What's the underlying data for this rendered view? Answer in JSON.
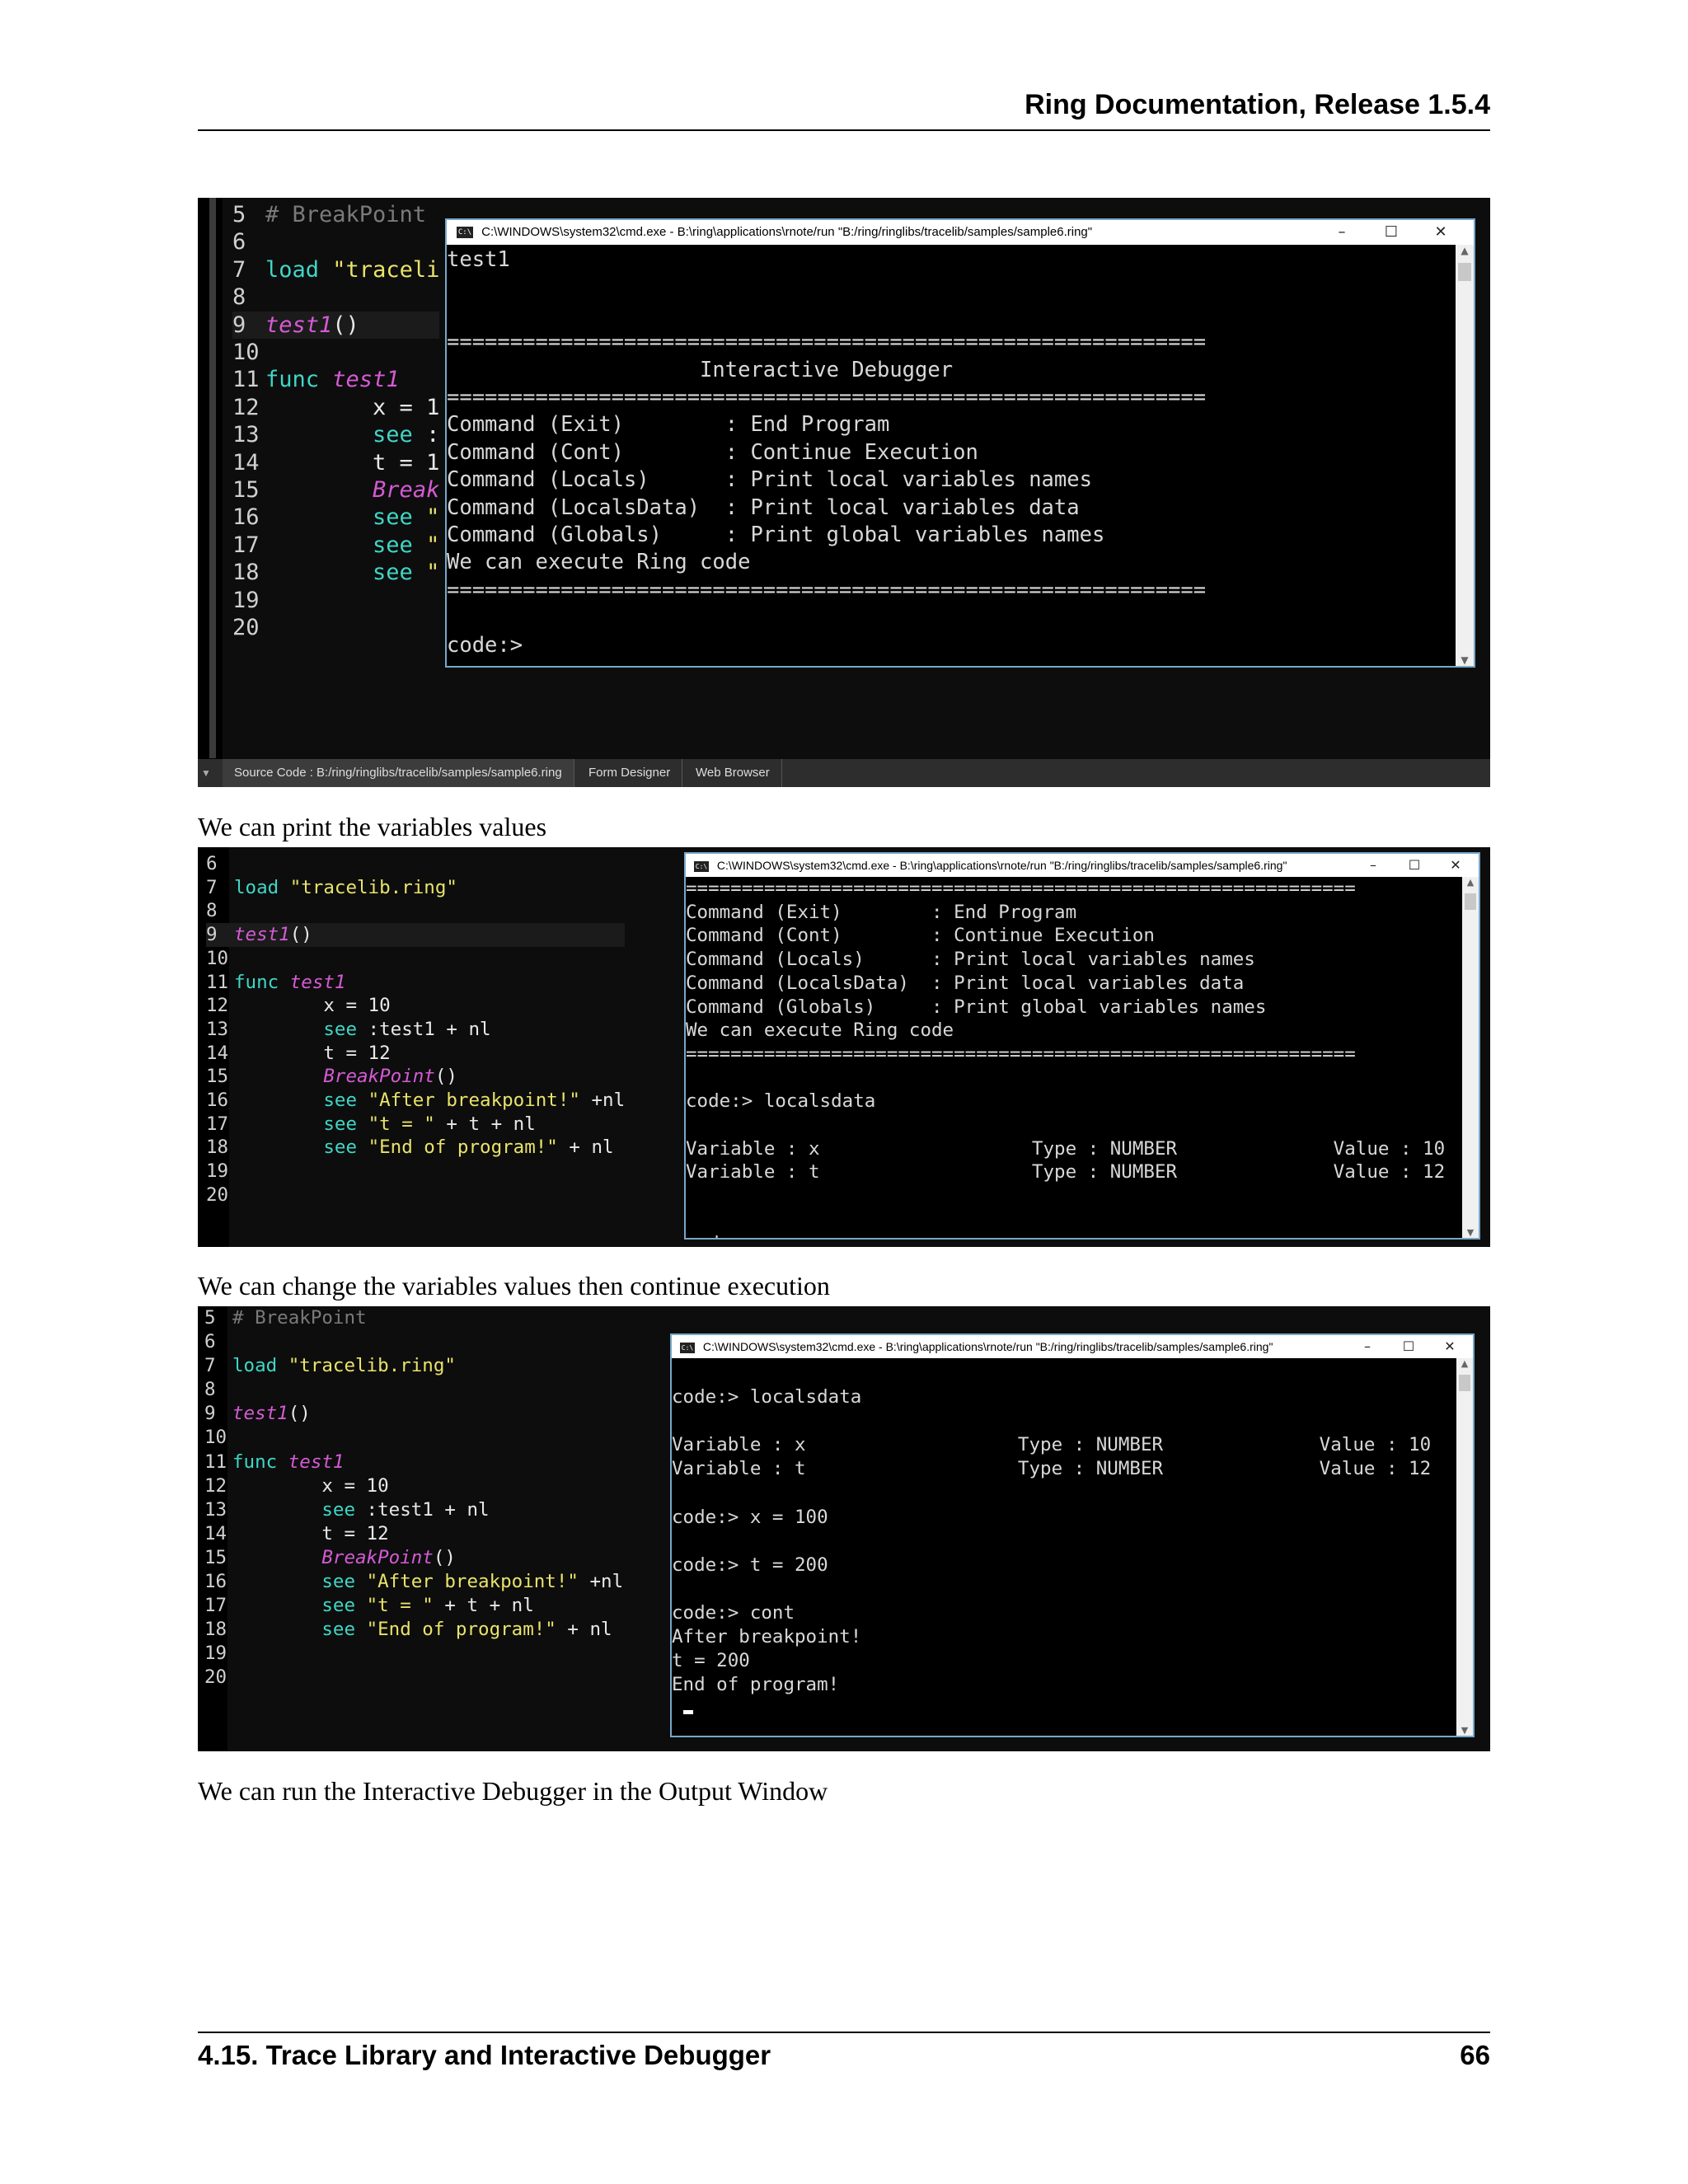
{
  "header": {
    "title": "Ring Documentation, Release 1.5.4"
  },
  "footer": {
    "section": "4.15.  Trace Library and Interactive Debugger",
    "page_number": "66"
  },
  "captions": {
    "print_values": "We can print the variables values",
    "change_values": "We can change the variables values then continue execution",
    "output_window": "We can run the Interactive Debugger in the Output Window"
  },
  "screenshot1": {
    "code_lines": [
      {
        "n": "5",
        "t": "# BreakPoint"
      },
      {
        "n": "6",
        "t": ""
      },
      {
        "n": "7",
        "t": "load \"traceli"
      },
      {
        "n": "8",
        "t": ""
      },
      {
        "n": "9",
        "t": "test1()"
      },
      {
        "n": "10",
        "t": ""
      },
      {
        "n": "11",
        "t": "func test1"
      },
      {
        "n": "12",
        "t": "        x = 1"
      },
      {
        "n": "13",
        "t": "        see :"
      },
      {
        "n": "14",
        "t": "        t = 1"
      },
      {
        "n": "15",
        "t": "        Break"
      },
      {
        "n": "16",
        "t": "        see \""
      },
      {
        "n": "17",
        "t": "        see \""
      },
      {
        "n": "18",
        "t": "        see \""
      },
      {
        "n": "19",
        "t": ""
      },
      {
        "n": "20",
        "t": ""
      }
    ],
    "terminal": {
      "title": "C:\\WINDOWS\\system32\\cmd.exe - B:\\ring\\applications\\rnote/run  \"B:/ring/ringlibs/tracelib/samples/sample6.ring\"",
      "lines": [
        "test1",
        "",
        "",
        "============================================================",
        "                    Interactive Debugger",
        "============================================================",
        "Command (Exit)        : End Program",
        "Command (Cont)        : Continue Execution",
        "Command (Locals)      : Print local variables names",
        "Command (LocalsData)  : Print local variables data",
        "Command (Globals)     : Print global variables names",
        "We can execute Ring code",
        "============================================================",
        "",
        "code:>"
      ]
    },
    "tabs": [
      "Source Code : B:/ring/ringlibs/tracelib/samples/sample6.ring",
      "Form Designer",
      "Web Browser"
    ]
  },
  "screenshot2": {
    "code_lines": [
      {
        "n": "6",
        "t": ""
      },
      {
        "n": "7",
        "t": "load \"tracelib.ring\""
      },
      {
        "n": "8",
        "t": ""
      },
      {
        "n": "9",
        "t": "test1()"
      },
      {
        "n": "10",
        "t": ""
      },
      {
        "n": "11",
        "t": "func test1"
      },
      {
        "n": "12",
        "t": "        x = 10"
      },
      {
        "n": "13",
        "t": "        see :test1 + nl"
      },
      {
        "n": "14",
        "t": "        t = 12"
      },
      {
        "n": "15",
        "t": "        BreakPoint()"
      },
      {
        "n": "16",
        "t": "        see \"After breakpoint!\" +nl"
      },
      {
        "n": "17",
        "t": "        see \"t = \" + t + nl"
      },
      {
        "n": "18",
        "t": "        see \"End of program!\" + nl"
      },
      {
        "n": "19",
        "t": ""
      },
      {
        "n": "20",
        "t": ""
      }
    ],
    "terminal": {
      "title": "C:\\WINDOWS\\system32\\cmd.exe - B:\\ring\\applications\\rnote/run  \"B:/ring/ringlibs/tracelib/samples/sample6.ring\"",
      "lines": [
        "============================================================",
        "Command (Exit)        : End Program",
        "Command (Cont)        : Continue Execution",
        "Command (Locals)      : Print local variables names",
        "Command (LocalsData)  : Print local variables data",
        "Command (Globals)     : Print global variables names",
        "We can execute Ring code",
        "============================================================",
        "",
        "code:> localsdata",
        "",
        "Variable : x                   Type : NUMBER              Value : 10",
        "Variable : t                   Type : NUMBER              Value : 12",
        "",
        "",
        "code:> "
      ]
    }
  },
  "screenshot3": {
    "code_lines": [
      {
        "n": "5",
        "t": "# BreakPoint"
      },
      {
        "n": "6",
        "t": ""
      },
      {
        "n": "7",
        "t": "load \"tracelib.ring\""
      },
      {
        "n": "8",
        "t": ""
      },
      {
        "n": "9",
        "t": "test1()"
      },
      {
        "n": "10",
        "t": ""
      },
      {
        "n": "11",
        "t": "func test1"
      },
      {
        "n": "12",
        "t": "        x = 10"
      },
      {
        "n": "13",
        "t": "        see :test1 + nl"
      },
      {
        "n": "14",
        "t": "        t = 12"
      },
      {
        "n": "15",
        "t": "        BreakPoint()"
      },
      {
        "n": "16",
        "t": "        see \"After breakpoint!\" +nl"
      },
      {
        "n": "17",
        "t": "        see \"t = \" + t + nl"
      },
      {
        "n": "18",
        "t": "        see \"End of program!\" + nl"
      },
      {
        "n": "19",
        "t": ""
      },
      {
        "n": "20",
        "t": ""
      }
    ],
    "terminal": {
      "title": "C:\\WINDOWS\\system32\\cmd.exe - B:\\ring\\applications\\rnote/run  \"B:/ring/ringlibs/tracelib/samples/sample6.ring\"",
      "lines": [
        "",
        "code:> localsdata",
        "",
        "Variable : x                   Type : NUMBER              Value : 10",
        "Variable : t                   Type : NUMBER              Value : 12",
        "",
        "code:> x = 100",
        "",
        "code:> t = 200",
        "",
        "code:> cont",
        "After breakpoint!",
        "t = 200",
        "End of program!",
        ""
      ]
    }
  },
  "window_buttons": {
    "minimize": "–",
    "maximize": "☐",
    "close": "✕"
  },
  "colors": {
    "keyword": "#3fd6c6",
    "string": "#e9e36a",
    "function": "#d45bd4",
    "comment": "#7a7a7a",
    "terminal_border": "#78a8c8"
  }
}
